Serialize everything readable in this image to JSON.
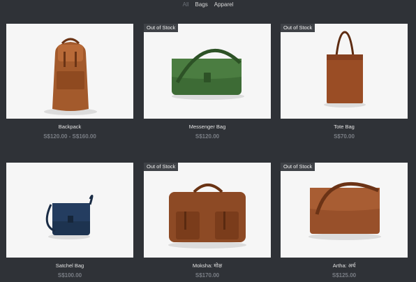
{
  "filters": [
    "All",
    "Bags",
    "Apparel"
  ],
  "products": [
    {
      "name": "Backpack",
      "price": "S$120.00 - S$160.00",
      "badge": "",
      "color": "#a35a2c"
    },
    {
      "name": "Messenger Bag",
      "price": "S$120.00",
      "badge": "Out of Stock",
      "color": "#3d6b35"
    },
    {
      "name": "Tote Bag",
      "price": "S$70.00",
      "badge": "Out of Stock",
      "color": "#9a4d25"
    },
    {
      "name": "Satchel Bag",
      "price": "S$100.00",
      "badge": "",
      "color": "#1d3350"
    },
    {
      "name": "Moksha: मोक्ष",
      "price": "S$170.00",
      "badge": "Out of Stock",
      "color": "#8d4a25"
    },
    {
      "name": "Artha: अर्थ",
      "price": "S$125.00",
      "badge": "Out of Stock",
      "color": "#98502a"
    }
  ]
}
